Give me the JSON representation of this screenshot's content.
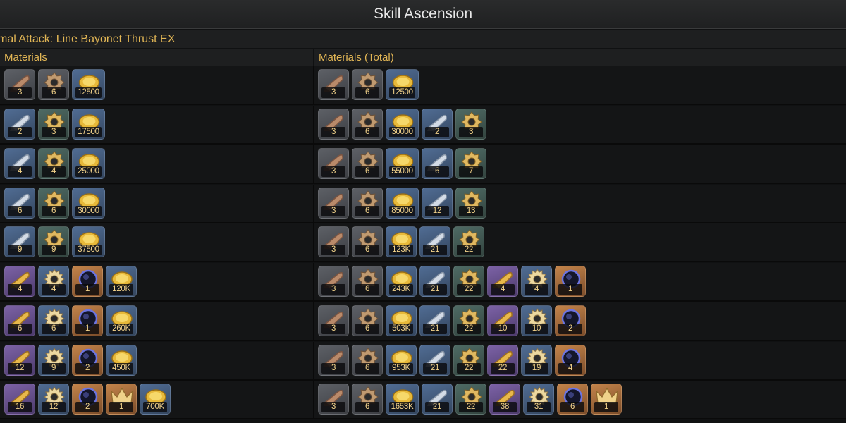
{
  "header": {
    "title": "Skill Ascension"
  },
  "skill": {
    "name": "mal Attack: Line Bayonet Thrust EX"
  },
  "columns": {
    "left": "Materials",
    "right": "Materials (Total)"
  },
  "colors": {
    "accent": "#e2b655",
    "title_text": "#e8e8e8",
    "background": "#101112"
  },
  "materials": {
    "bullet_bronze": {
      "icon": "bronze-bullet-icon",
      "tier": "grey"
    },
    "gear_bronze": {
      "icon": "bronze-gear-icon",
      "tier": "grey"
    },
    "coin": {
      "icon": "gold-coin-icon",
      "tier": "blue"
    },
    "bullet_silver": {
      "icon": "silver-bullet-icon",
      "tier": "blue"
    },
    "gear_gold": {
      "icon": "gold-gear-icon",
      "tier": "green"
    },
    "bullet_gold": {
      "icon": "gold-bullet-icon",
      "tier": "purple"
    },
    "gear_spiked": {
      "icon": "spiked-gear-icon",
      "tier": "blue"
    },
    "dark_orb": {
      "icon": "dark-orb-icon",
      "tier": "orange"
    },
    "crown": {
      "icon": "crown-icon",
      "tier": "orange"
    }
  },
  "rows": [
    {
      "materials": [
        [
          "bullet_bronze",
          "3"
        ],
        [
          "gear_bronze",
          "6"
        ],
        [
          "coin",
          "12500"
        ]
      ],
      "totals": [
        [
          "bullet_bronze",
          "3"
        ],
        [
          "gear_bronze",
          "6"
        ],
        [
          "coin",
          "12500"
        ]
      ]
    },
    {
      "materials": [
        [
          "bullet_silver",
          "2"
        ],
        [
          "gear_gold",
          "3"
        ],
        [
          "coin",
          "17500"
        ]
      ],
      "totals": [
        [
          "bullet_bronze",
          "3"
        ],
        [
          "gear_bronze",
          "6"
        ],
        [
          "coin",
          "30000"
        ],
        [
          "bullet_silver",
          "2"
        ],
        [
          "gear_gold",
          "3"
        ]
      ]
    },
    {
      "materials": [
        [
          "bullet_silver",
          "4"
        ],
        [
          "gear_gold",
          "4"
        ],
        [
          "coin",
          "25000"
        ]
      ],
      "totals": [
        [
          "bullet_bronze",
          "3"
        ],
        [
          "gear_bronze",
          "6"
        ],
        [
          "coin",
          "55000"
        ],
        [
          "bullet_silver",
          "6"
        ],
        [
          "gear_gold",
          "7"
        ]
      ]
    },
    {
      "materials": [
        [
          "bullet_silver",
          "6"
        ],
        [
          "gear_gold",
          "6"
        ],
        [
          "coin",
          "30000"
        ]
      ],
      "totals": [
        [
          "bullet_bronze",
          "3"
        ],
        [
          "gear_bronze",
          "6"
        ],
        [
          "coin",
          "85000"
        ],
        [
          "bullet_silver",
          "12"
        ],
        [
          "gear_gold",
          "13"
        ]
      ]
    },
    {
      "materials": [
        [
          "bullet_silver",
          "9"
        ],
        [
          "gear_gold",
          "9"
        ],
        [
          "coin",
          "37500"
        ]
      ],
      "totals": [
        [
          "bullet_bronze",
          "3"
        ],
        [
          "gear_bronze",
          "6"
        ],
        [
          "coin",
          "123K"
        ],
        [
          "bullet_silver",
          "21"
        ],
        [
          "gear_gold",
          "22"
        ]
      ]
    },
    {
      "materials": [
        [
          "bullet_gold",
          "4"
        ],
        [
          "gear_spiked",
          "4"
        ],
        [
          "dark_orb",
          "1"
        ],
        [
          "coin",
          "120K"
        ]
      ],
      "totals": [
        [
          "bullet_bronze",
          "3"
        ],
        [
          "gear_bronze",
          "6"
        ],
        [
          "coin",
          "243K"
        ],
        [
          "bullet_silver",
          "21"
        ],
        [
          "gear_gold",
          "22"
        ],
        [
          "bullet_gold",
          "4"
        ],
        [
          "gear_spiked",
          "4"
        ],
        [
          "dark_orb",
          "1"
        ]
      ]
    },
    {
      "materials": [
        [
          "bullet_gold",
          "6"
        ],
        [
          "gear_spiked",
          "6"
        ],
        [
          "dark_orb",
          "1"
        ],
        [
          "coin",
          "260K"
        ]
      ],
      "totals": [
        [
          "bullet_bronze",
          "3"
        ],
        [
          "gear_bronze",
          "6"
        ],
        [
          "coin",
          "503K"
        ],
        [
          "bullet_silver",
          "21"
        ],
        [
          "gear_gold",
          "22"
        ],
        [
          "bullet_gold",
          "10"
        ],
        [
          "gear_spiked",
          "10"
        ],
        [
          "dark_orb",
          "2"
        ]
      ]
    },
    {
      "materials": [
        [
          "bullet_gold",
          "12"
        ],
        [
          "gear_spiked",
          "9"
        ],
        [
          "dark_orb",
          "2"
        ],
        [
          "coin",
          "450K"
        ]
      ],
      "totals": [
        [
          "bullet_bronze",
          "3"
        ],
        [
          "gear_bronze",
          "6"
        ],
        [
          "coin",
          "953K"
        ],
        [
          "bullet_silver",
          "21"
        ],
        [
          "gear_gold",
          "22"
        ],
        [
          "bullet_gold",
          "22"
        ],
        [
          "gear_spiked",
          "19"
        ],
        [
          "dark_orb",
          "4"
        ]
      ]
    },
    {
      "materials": [
        [
          "bullet_gold",
          "16"
        ],
        [
          "gear_spiked",
          "12"
        ],
        [
          "dark_orb",
          "2"
        ],
        [
          "crown",
          "1"
        ],
        [
          "coin",
          "700K"
        ]
      ],
      "totals": [
        [
          "bullet_bronze",
          "3"
        ],
        [
          "gear_bronze",
          "6"
        ],
        [
          "coin",
          "1653K"
        ],
        [
          "bullet_silver",
          "21"
        ],
        [
          "gear_gold",
          "22"
        ],
        [
          "bullet_gold",
          "38"
        ],
        [
          "gear_spiked",
          "31"
        ],
        [
          "dark_orb",
          "6"
        ],
        [
          "crown",
          "1"
        ]
      ]
    }
  ]
}
